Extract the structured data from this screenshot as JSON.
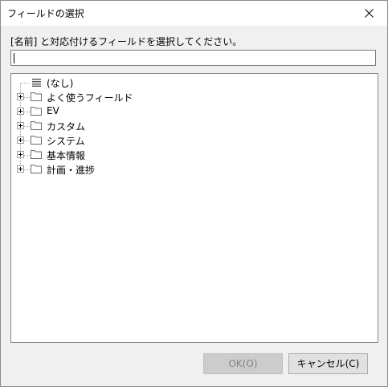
{
  "dialog": {
    "title": "フィールドの選択",
    "prompt": "[名前] と対応付けるフィールドを選択してください。"
  },
  "search": {
    "value": "",
    "placeholder": ""
  },
  "tree": {
    "items": [
      {
        "label": "(なし)",
        "icon": "list-icon",
        "expandable": false
      },
      {
        "label": "よく使うフィールド",
        "icon": "folder-icon",
        "expandable": true
      },
      {
        "label": "EV",
        "icon": "folder-icon",
        "expandable": true
      },
      {
        "label": "カスタム",
        "icon": "folder-icon",
        "expandable": true
      },
      {
        "label": "システム",
        "icon": "folder-icon",
        "expandable": true
      },
      {
        "label": "基本情報",
        "icon": "folder-icon",
        "expandable": true
      },
      {
        "label": "計画・進捗",
        "icon": "folder-icon",
        "expandable": true
      }
    ]
  },
  "buttons": {
    "ok_label": "OK(O)",
    "ok_enabled": false,
    "cancel_label": "キャンセル(C)"
  },
  "colors": {
    "dialog_bg": "#f0f0f0",
    "title_bg": "#ffffff",
    "disabled_button": "#cccccc",
    "button": "#e1e1e1"
  }
}
